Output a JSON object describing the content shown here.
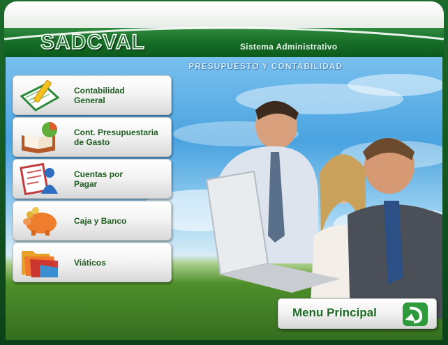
{
  "header": {
    "logo_text": "SADCVAL",
    "subtitle": "Sistema Administrativo"
  },
  "section_title": "PRESUPUESTO Y CONTABILIDAD",
  "menu": [
    {
      "label": "Contabilidad\nGeneral",
      "icon": "notebook-pencil-icon"
    },
    {
      "label": "Cont. Presupuestaria\nde Gasto",
      "icon": "book-pie-chart-icon"
    },
    {
      "label": "Cuentas por\nPagar",
      "icon": "invoice-person-icon"
    },
    {
      "label": "Caja y Banco",
      "icon": "piggy-bank-icon"
    },
    {
      "label": "Viáticos",
      "icon": "folders-icon"
    }
  ],
  "main_menu_button": {
    "label": "Menu Principal",
    "icon": "return-arrow-icon"
  },
  "colors": {
    "brand_green": "#1a7a2a",
    "label_green": "#1d5e1f"
  }
}
